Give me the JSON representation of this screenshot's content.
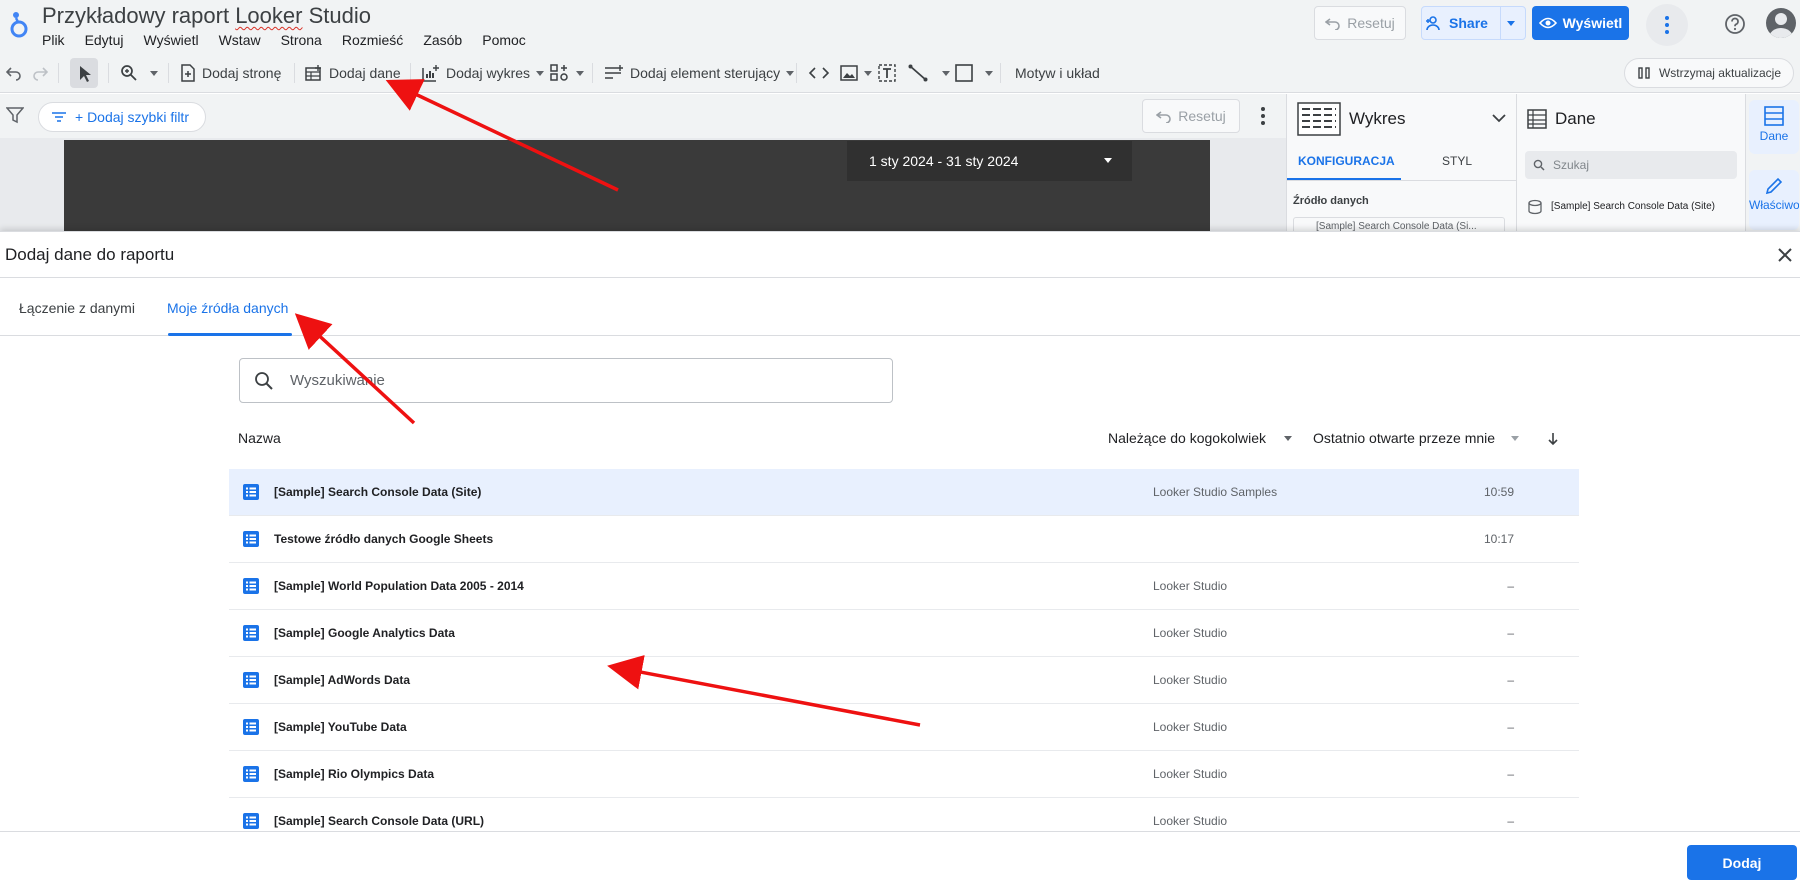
{
  "header": {
    "title_prefix": "Przykładowy raport ",
    "title_underlined": "Looker",
    "title_suffix": " Studio",
    "menu": [
      "Plik",
      "Edytuj",
      "Wyświetl",
      "Wstaw",
      "Strona",
      "Rozmieść",
      "Zasób",
      "Pomoc"
    ],
    "reset_label": "Resetuj",
    "share_label": "Share",
    "view_label": "Wyświetl"
  },
  "toolbar": {
    "add_page": "Dodaj stronę",
    "add_data": "Dodaj dane",
    "add_chart": "Dodaj wykres",
    "add_control": "Dodaj element sterujący",
    "theme": "Motyw i układ",
    "pause": "Wstrzymaj aktualizacje"
  },
  "canvas": {
    "quick_filter": "+ Dodaj szybki filtr",
    "reset_label": "Resetuj",
    "date_range": "1 sty 2024 - 31 sty 2024"
  },
  "chart_panel": {
    "title": "Wykres",
    "tab_config": "KONFIGURACJA",
    "tab_style": "STYL",
    "source_label": "Źródło danych",
    "source_value": "[Sample] Search Console Data (Si..."
  },
  "data_panel": {
    "title": "Dane",
    "search_placeholder": "Szukaj",
    "source_item": "[Sample] Search Console Data (Site)"
  },
  "rail": {
    "data": "Dane",
    "properties": "Właściwości"
  },
  "dialog": {
    "title": "Dodaj dane do raportu",
    "tab_connect": "Łączenie z danymi",
    "tab_mine": "Moje źródła danych",
    "search_placeholder": "Wyszukiwanie",
    "col_name": "Nazwa",
    "col_owner": "Należące do kogokolwiek",
    "col_opened": "Ostatnio otwarte przeze mnie",
    "rows": [
      {
        "name": "[Sample] Search Console Data (Site)",
        "owner": "Looker Studio Samples",
        "time": "10:59"
      },
      {
        "name": "Testowe źródło  danych Google Sheets",
        "owner": "",
        "time": "10:17"
      },
      {
        "name": "[Sample] World Population Data 2005 - 2014",
        "owner": "Looker Studio",
        "time": "–"
      },
      {
        "name": "[Sample] Google Analytics Data",
        "owner": "Looker Studio",
        "time": "–"
      },
      {
        "name": "[Sample] AdWords Data",
        "owner": "Looker Studio",
        "time": "–"
      },
      {
        "name": "[Sample] YouTube Data",
        "owner": "Looker Studio",
        "time": "–"
      },
      {
        "name": "[Sample] Rio Olympics Data",
        "owner": "Looker Studio",
        "time": "–"
      },
      {
        "name": "[Sample] Search Console Data (URL)",
        "owner": "Looker Studio",
        "time": "–"
      }
    ],
    "add_button": "Dodaj"
  },
  "colors": {
    "accent": "#1a73e8",
    "annotation": "#ee1111"
  }
}
